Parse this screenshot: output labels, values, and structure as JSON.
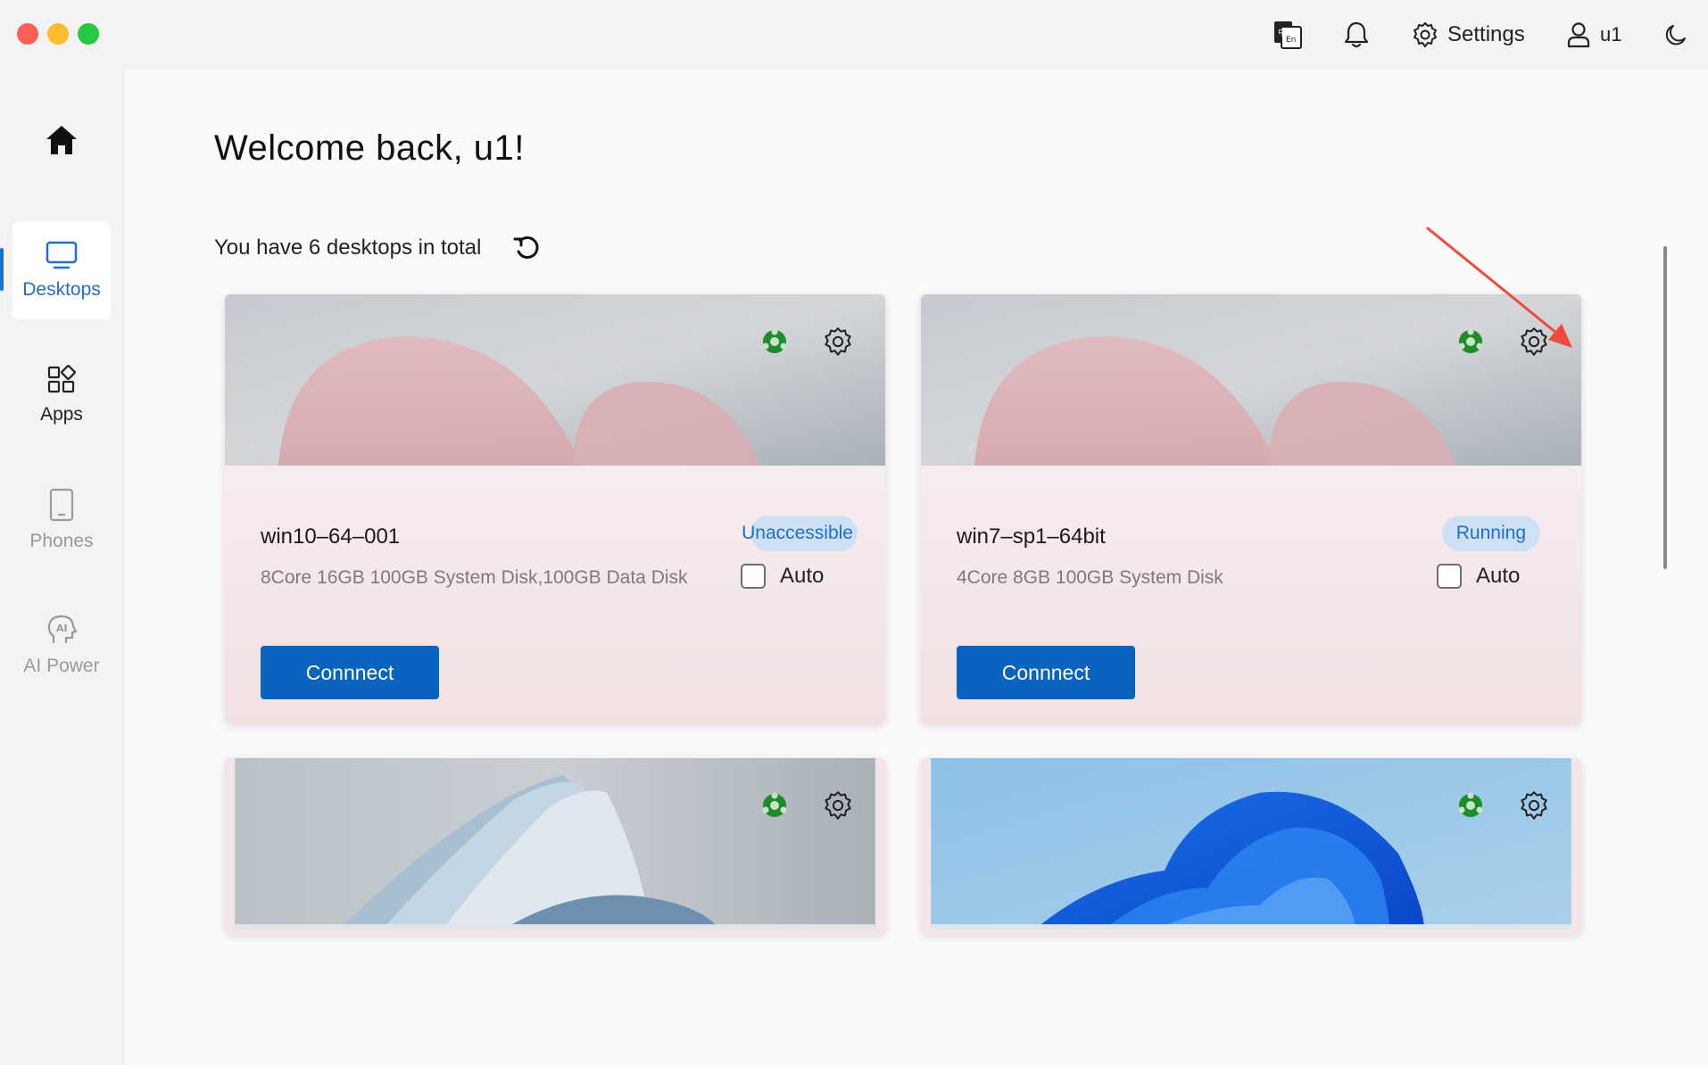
{
  "header": {
    "settings_label": "Settings",
    "user_label": "u1"
  },
  "sidebar": {
    "items": [
      {
        "label": ""
      },
      {
        "label": "Desktops"
      },
      {
        "label": "Apps"
      },
      {
        "label": "Phones"
      },
      {
        "label": "AI Power"
      }
    ]
  },
  "main": {
    "welcome": "Welcome back, u1!",
    "summary": "You have 6 desktops in total",
    "cards": [
      {
        "name": "win10–64–001",
        "spec": "8Core 16GB 100GB System Disk,100GB Data Disk",
        "status": "Unaccessible",
        "auto_label": "Auto",
        "auto_checked": false,
        "connect_label": "Connnect"
      },
      {
        "name": "win7–sp1–64bit",
        "spec": "4Core 8GB 100GB System Disk",
        "status": "Running",
        "auto_label": "Auto",
        "auto_checked": false,
        "connect_label": "Connnect"
      }
    ]
  },
  "colors": {
    "accent": "#1f6fcf",
    "button": "#0a63be",
    "status_bg": "#cfe0f4",
    "network_icon": "#1e8c2a",
    "annotation_arrow": "#f04a3c"
  }
}
